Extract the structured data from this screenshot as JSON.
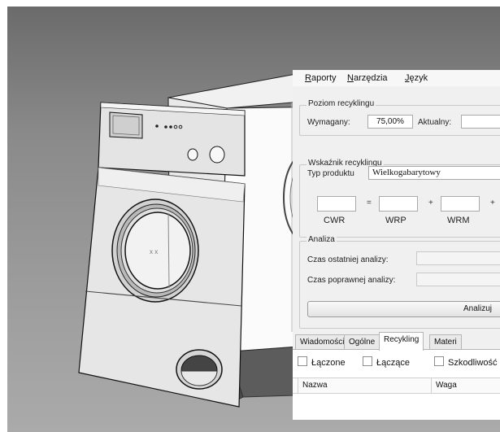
{
  "menu": {
    "items": [
      {
        "label": "Raporty",
        "hotkey": "R"
      },
      {
        "label": "Narzędzia",
        "hotkey": "N"
      },
      {
        "label": "Język",
        "hotkey": "J"
      }
    ]
  },
  "recycling_level": {
    "group_title": "Poziom recyklingu",
    "required_label": "Wymagany:",
    "required_value": "75,00%",
    "current_label": "Aktualny:",
    "current_value": ""
  },
  "recycling_index": {
    "group_title": "Wskaźnik recyklingu",
    "product_type_label": "Typ produktu",
    "product_type_value": "Wielkogabarytowy",
    "formula": {
      "fields": [
        "",
        "",
        ""
      ],
      "operators": [
        "=",
        "+",
        "+"
      ],
      "captions": [
        "CWR",
        "WRP",
        "WRM"
      ]
    }
  },
  "analysis": {
    "group_title": "Analiza",
    "last_label": "Czas ostatniej analizy:",
    "last_value": "",
    "valid_label": "Czas poprawnej analizy:",
    "valid_value": "",
    "analyze_button": "Analizuj"
  },
  "tabs": [
    {
      "label": "Wiadomości",
      "active": false
    },
    {
      "label": "Ogólne",
      "active": false
    },
    {
      "label": "Recykling",
      "active": true
    },
    {
      "label": "Materi",
      "active": false
    }
  ],
  "filters": [
    {
      "label": "Łączone",
      "checked": false
    },
    {
      "label": "Łączące",
      "checked": false
    },
    {
      "label": "Szkodliwość",
      "checked": false
    }
  ],
  "table": {
    "columns": [
      "Nazwa",
      "Waga"
    ]
  }
}
